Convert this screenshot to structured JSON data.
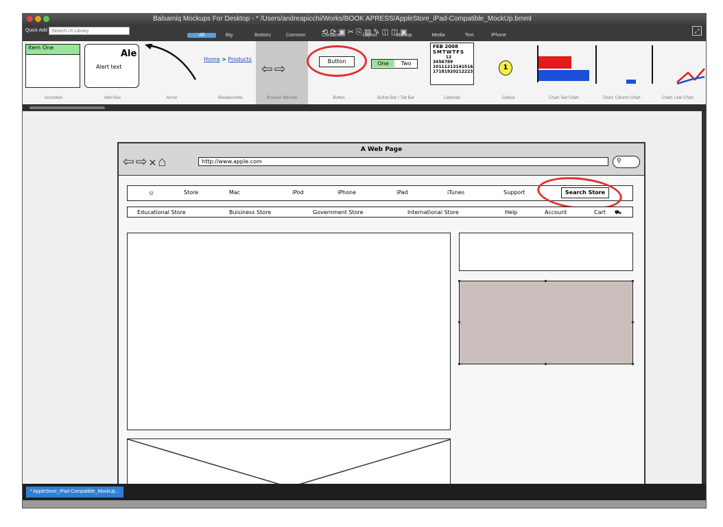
{
  "app": {
    "window_title": "Balsamiq Mockups For Desktop - * /Users/andreapicchi/Works/BOOK APRESS/AppleStore_iPad-Compatible_MockUp.bmml"
  },
  "quick_add": {
    "label": "Quick Add",
    "placeholder": "Search UI Library"
  },
  "category_tabs": [
    "All",
    "Big",
    "Buttons",
    "Common",
    "Containers",
    "Layout",
    "Markup",
    "Media",
    "Text",
    "iPhone"
  ],
  "library": {
    "accordion": {
      "item": "Item One",
      "caption": "Accordion"
    },
    "alert": {
      "title": "Ale",
      "text": "Alert text",
      "caption": "Alert Box"
    },
    "arrow": {
      "caption": "Arrow"
    },
    "breadcrumbs": {
      "home": "Home",
      "separator": ">",
      "products": "Products",
      "caption": "Breadcrumbs"
    },
    "browser": {
      "caption": "Browser Window"
    },
    "button": {
      "label": "Button",
      "caption": "Button"
    },
    "buttonbar": {
      "one": "One",
      "two": "Two",
      "caption": "Button Bar / Tab Bar"
    },
    "calendar": {
      "header": "FEB 2008",
      "days": "SMTWTFS",
      "caption": "Calendar"
    },
    "callout": {
      "number": "1",
      "caption": "Callout"
    },
    "barchart": {
      "caption": "Chart: Bar Chart"
    },
    "columnchart": {
      "caption": "Chart: Column Chart"
    },
    "linechart": {
      "caption": "Chart: Line Chart"
    }
  },
  "mockup": {
    "title": "A Web Page",
    "url": "http://www.apple.com",
    "nav": [
      "Store",
      "Mac",
      "iPod",
      "iPhone",
      "iPad",
      "iTunes",
      "Support"
    ],
    "search_store": "Search Store",
    "subnav": [
      "Educational Store",
      "Buisiness Store",
      "Government Store",
      "International Store",
      "Help",
      "Account",
      "Cart"
    ]
  },
  "document_tab": "* AppleStore_iPad-Compatible_MockUp..."
}
